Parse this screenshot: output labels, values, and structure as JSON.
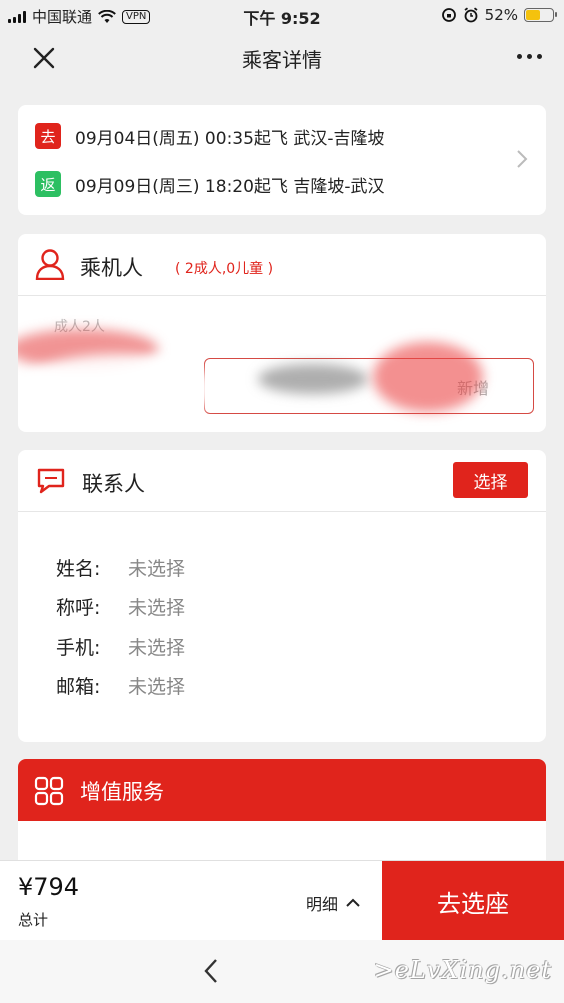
{
  "status_bar": {
    "carrier": "中国联通",
    "vpn": "VPN",
    "time": "下午 9:52",
    "battery": "52%",
    "battery_level": 0.52
  },
  "nav": {
    "title": "乘客详情"
  },
  "flights": [
    {
      "tag": "去",
      "tag_color": "#e0241c",
      "text": "09月04日(周五) 00:35起飞 武汉-吉隆坡"
    },
    {
      "tag": "返",
      "tag_color": "#2dbf62",
      "text": "09月09日(周三) 18:20起飞 吉隆坡-武汉"
    }
  ],
  "passengers": {
    "title": "乘机人",
    "count": "( 2成人,0儿童 )",
    "sub_label": "成人2人",
    "add_label": "新增"
  },
  "contact": {
    "title": "联系人",
    "select_label": "选择",
    "fields": [
      {
        "key": "姓名:",
        "value": "未选择"
      },
      {
        "key": "称呼:",
        "value": "未选择"
      },
      {
        "key": "手机:",
        "value": "未选择"
      },
      {
        "key": "邮箱:",
        "value": "未选择"
      }
    ]
  },
  "value_added": {
    "title": "增值服务"
  },
  "bottom_bar": {
    "price": "¥794",
    "total_label": "总计",
    "detail_label": "明细",
    "cta_label": "去选座"
  },
  "watermark": ">eLvXing.net",
  "colors": {
    "accent": "#e0241c",
    "return_tag": "#2dbf62"
  }
}
